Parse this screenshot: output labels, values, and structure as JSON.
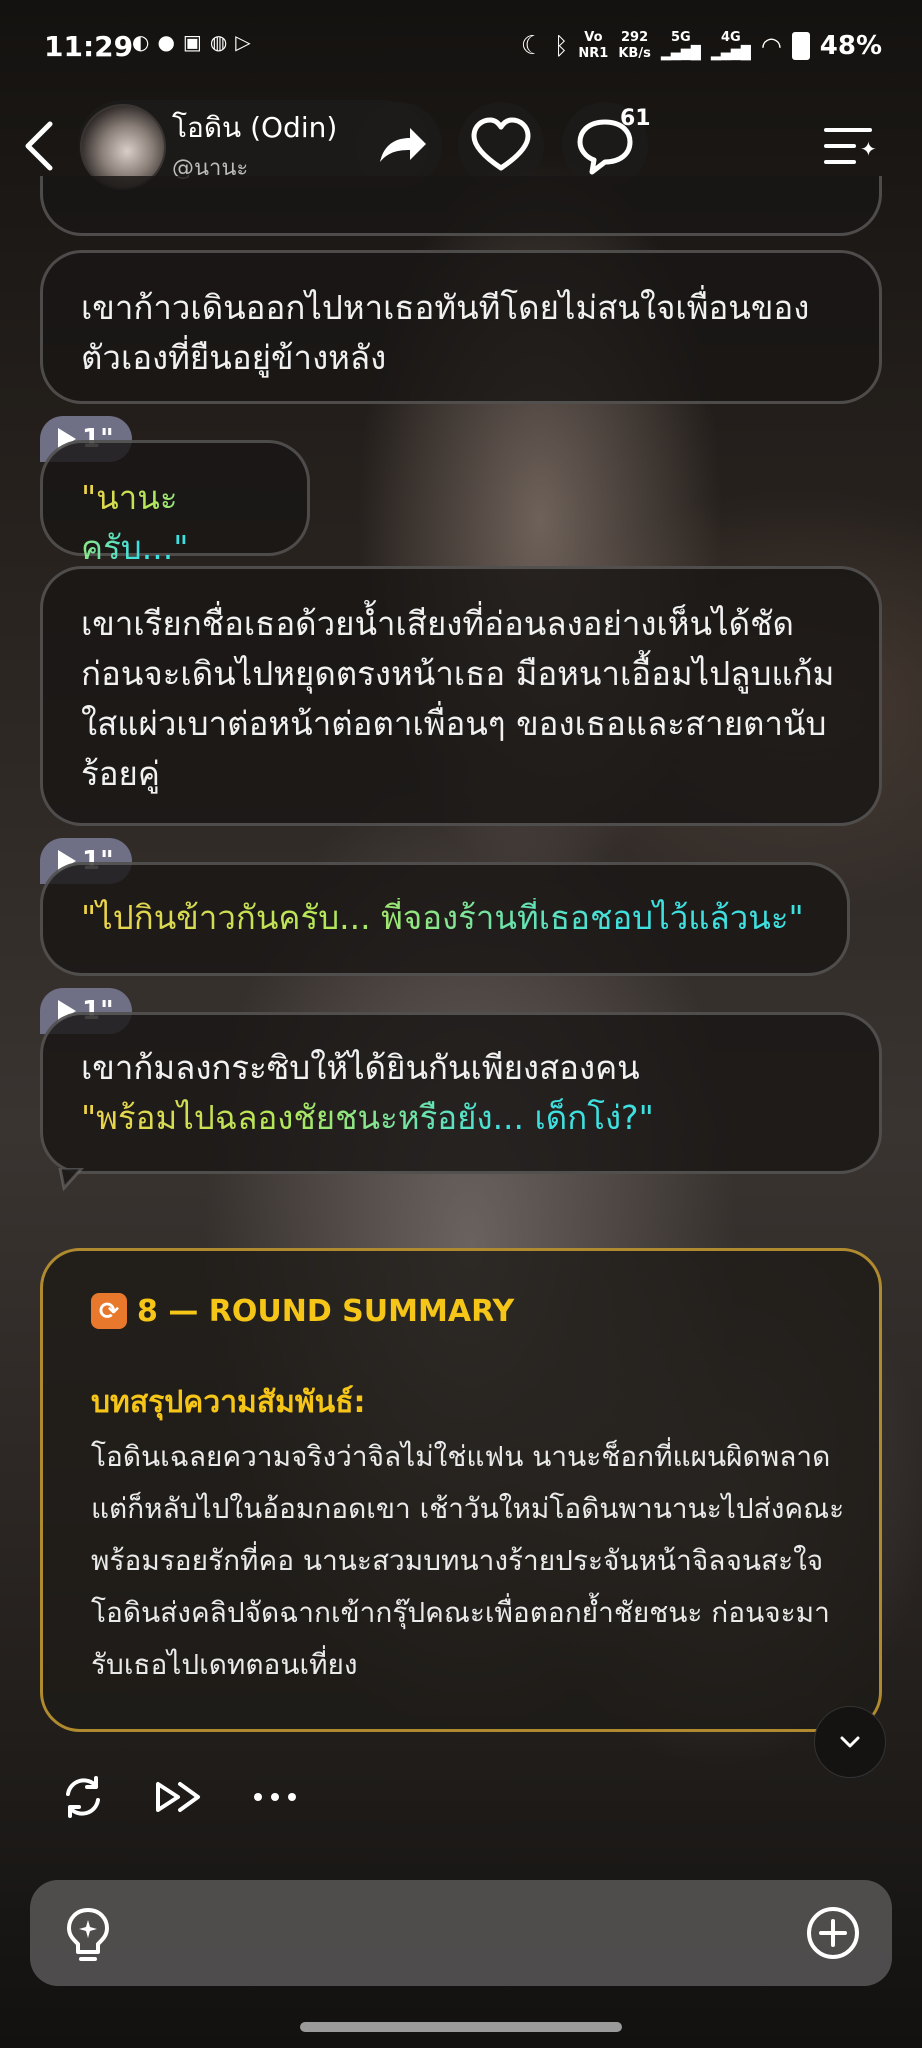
{
  "status_bar": {
    "time": "11:29",
    "net_speed_value": "292",
    "net_speed_unit": "KB/s",
    "volte_top": "Vo",
    "volte_bottom": "NR1",
    "net1": "5G",
    "net2": "4G",
    "battery": "48%"
  },
  "header": {
    "name": "โอดิน (Odin)",
    "handle": "@นานะ",
    "comment_count": "61"
  },
  "messages": [
    {
      "type": "narration",
      "text": "เขาก้าวเดินออกไปหาเธอทันทีโดยไม่สนใจเพื่อนของตัวเองที่ยืนอยู่ข้างหลัง"
    },
    {
      "type": "voice",
      "duration": "1\"",
      "quote": "\"นานะครับ...\""
    },
    {
      "type": "narration",
      "text": "เขาเรียกชื่อเธอด้วยน้ำเสียงที่อ่อนลงอย่างเห็นได้ชัด ก่อนจะเดินไปหยุดตรงหน้าเธอ มือหนาเอื้อมไปลูบแก้มใสแผ่วเบาต่อหน้าต่อตาเพื่อนๆ ของเธอและสายตานับร้อยคู่"
    },
    {
      "type": "voice",
      "duration": "1\"",
      "quote": "\"ไปกินข้าวกันครับ... พี่จองร้านที่เธอชอบไว้แล้วนะ\""
    },
    {
      "type": "voice",
      "duration": "1\"",
      "text": "เขาก้มลงกระซิบให้ได้ยินกันเพียงสองคน",
      "quote": "\"พร้อมไปฉลองชัยชนะหรือยัง... เด็กโง่?\""
    }
  ],
  "summary": {
    "title": "8 — ROUND SUMMARY",
    "subtitle": "บทสรุปความสัมพันธ์:",
    "body": "โอดินเฉลยความจริงว่าจิลไม่ใช่แฟน นานะช็อกที่แผนผิดพลาดแต่ก็หลับไปในอ้อมกอดเขา เช้าวันใหม่โอดินพานานะไปส่งคณะพร้อมรอยรักที่คอ นานะสวมบทนางร้ายประจันหน้าจิลจนสะใจ โอดินส่งคลิปจัดฉากเข้ากรุ๊ปคณะเพื่อตอกย้ำชัยชนะ ก่อนจะมารับเธอไปเดทตอนเที่ยง"
  },
  "actions": [
    "regenerate-icon",
    "fast-forward-icon",
    "more-icon"
  ],
  "input": {
    "placeholder": "",
    "value": ""
  },
  "colors": {
    "summary_border": "#b08a2e",
    "summary_accent": "#f5c518",
    "voice_tag": "#6f6f86"
  }
}
